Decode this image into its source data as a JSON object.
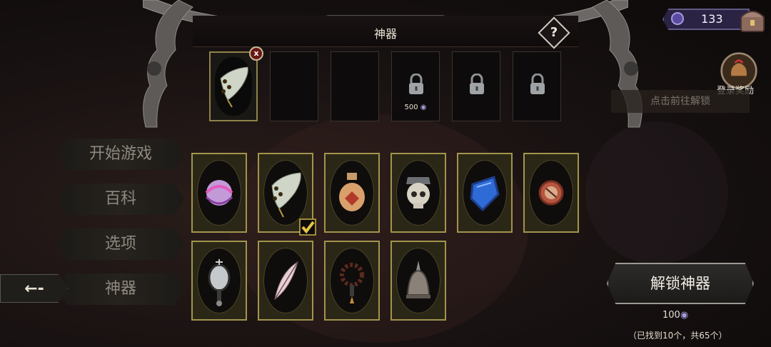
{
  "panel": {
    "title": "神器",
    "help_label": "?"
  },
  "equipped_slots": [
    {
      "state": "filled",
      "icon": "horn-icon"
    },
    {
      "state": "empty"
    },
    {
      "state": "empty"
    },
    {
      "state": "locked",
      "cost": "500"
    },
    {
      "state": "locked"
    },
    {
      "state": "locked"
    }
  ],
  "remove_label": "x",
  "menu": {
    "items": [
      {
        "label": "开始游戏"
      },
      {
        "label": "百科"
      },
      {
        "label": "选项"
      },
      {
        "label": "神器"
      }
    ],
    "back_label": "←-"
  },
  "artifacts": [
    {
      "icon": "purple-orb-icon",
      "equipped": false
    },
    {
      "icon": "horn-icon",
      "equipped": true
    },
    {
      "icon": "potion-flask-icon",
      "equipped": false
    },
    {
      "icon": "skull-icon",
      "equipped": false
    },
    {
      "icon": "blue-shield-icon",
      "equipped": false
    },
    {
      "icon": "compass-icon",
      "equipped": false
    },
    {
      "icon": "hand-mirror-icon",
      "equipped": false
    },
    {
      "icon": "feather-icon",
      "equipped": false
    },
    {
      "icon": "prayer-beads-icon",
      "equipped": false
    },
    {
      "icon": "bell-icon",
      "equipped": false
    }
  ],
  "unlock": {
    "button_label": "解锁神器",
    "cost": "100",
    "found_text": "（已找到10个，共65个）"
  },
  "currency": {
    "value": "133"
  },
  "login_reward": {
    "label": "登录奖励"
  },
  "unlock_hint": "点击前往解锁",
  "colors": {
    "card_border": "#a2944d",
    "currency_bg": "#2a2344",
    "accent_gold": "#c9b24a"
  }
}
